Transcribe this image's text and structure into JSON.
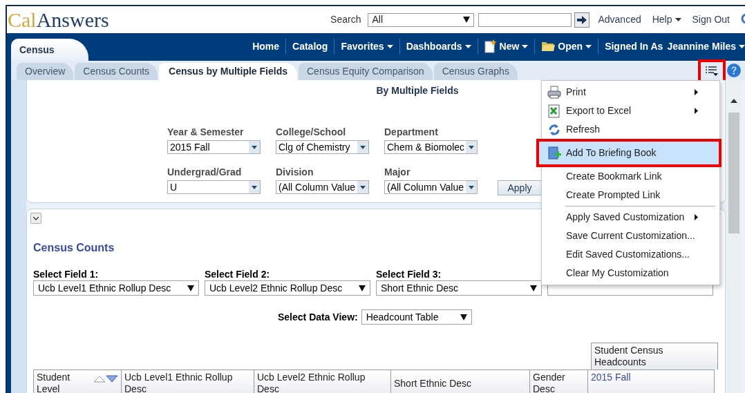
{
  "header": {
    "logo": {
      "first": "Cal",
      "second": "Answers"
    },
    "search_label": "Search",
    "search_scope": "All",
    "links": [
      {
        "label": "Advanced",
        "has_menu": false
      },
      {
        "label": "Help",
        "has_menu": true
      },
      {
        "label": "Sign Out",
        "has_menu": false
      }
    ]
  },
  "nav": {
    "page_tab": "Census",
    "items": [
      {
        "label": "Home",
        "has_menu": false
      },
      {
        "label": "Catalog",
        "has_menu": false
      },
      {
        "label": "Favorites",
        "has_menu": true
      },
      {
        "label": "Dashboards",
        "has_menu": true
      },
      {
        "label": "New",
        "has_menu": true
      },
      {
        "label": "Open",
        "has_menu": true
      }
    ],
    "signed_in_label": "Signed In As",
    "user": "Jeannine Miles",
    "user_has_menu": true
  },
  "tabs": [
    {
      "label": "Overview",
      "selected": false
    },
    {
      "label": "Census Counts",
      "selected": false
    },
    {
      "label": "Census by Multiple Fields",
      "selected": true
    },
    {
      "label": "Census Equity Comparison",
      "selected": false
    },
    {
      "label": "Census Graphs",
      "selected": false
    }
  ],
  "page_options": {
    "highlighted": true
  },
  "prompts": {
    "title": "By Multiple Fields",
    "fields": [
      {
        "label": "Year & Semester",
        "value": "2015 Fall"
      },
      {
        "label": "College/School",
        "value": "Clg of Chemistry"
      },
      {
        "label": "Department",
        "value": "Chem & Biomolec"
      },
      {
        "label": "Undergrad/Grad",
        "value": "U"
      },
      {
        "label": "Division",
        "value": "(All Column Value"
      },
      {
        "label": "Major",
        "value": "(All Column Value"
      }
    ],
    "apply": "Apply"
  },
  "section": {
    "title": "Census Counts",
    "select_fields": [
      {
        "label": "Select Field 1:",
        "value": "Ucb Level1 Ethnic Rollup Desc"
      },
      {
        "label": "Select Field 2:",
        "value": "Ucb Level2 Ethnic Rollup Desc"
      },
      {
        "label": "Select Field 3:",
        "value": "Short Ethnic Desc"
      }
    ],
    "data_view": {
      "label": "Select Data View:",
      "value": "Headcount Table"
    }
  },
  "table": {
    "group_header": "Student Census Headcounts",
    "columns": [
      {
        "label": "Student Level",
        "sortable": true
      },
      {
        "label": "Ucb Level1 Ethnic Rollup Desc",
        "sortable": false
      },
      {
        "label": "Ucb Level2 Ethnic Rollup Desc",
        "sortable": false
      },
      {
        "label": "Short Ethnic Desc",
        "sortable": false
      },
      {
        "label": "Gender Desc",
        "sortable": false
      },
      {
        "label": "2015 Fall",
        "sortable": false
      }
    ]
  },
  "menu": {
    "items": [
      {
        "kind": "item",
        "label": "Print",
        "has_submenu": true,
        "selected": false,
        "highlighted": false
      },
      {
        "kind": "item",
        "label": "Export to Excel",
        "has_submenu": true,
        "selected": false,
        "highlighted": false
      },
      {
        "kind": "item",
        "label": "Refresh",
        "has_submenu": false,
        "selected": false,
        "highlighted": false
      },
      {
        "kind": "item",
        "label": "Add To Briefing Book",
        "has_submenu": false,
        "selected": true,
        "highlighted": true
      },
      {
        "kind": "item",
        "label": "Create Bookmark Link",
        "has_submenu": false,
        "selected": false,
        "highlighted": false
      },
      {
        "kind": "item",
        "label": "Create Prompted Link",
        "has_submenu": false,
        "selected": false,
        "highlighted": false
      },
      {
        "kind": "separator"
      },
      {
        "kind": "item",
        "label": "Apply Saved Customization",
        "has_submenu": true,
        "selected": false,
        "highlighted": false
      },
      {
        "kind": "item",
        "label": "Save Current Customization...",
        "has_submenu": false,
        "selected": false,
        "highlighted": false
      },
      {
        "kind": "item",
        "label": "Edit Saved Customizations...",
        "has_submenu": false,
        "selected": false,
        "highlighted": false
      },
      {
        "kind": "item",
        "label": "Clear My Customization",
        "has_submenu": false,
        "selected": false,
        "highlighted": false
      }
    ]
  }
}
